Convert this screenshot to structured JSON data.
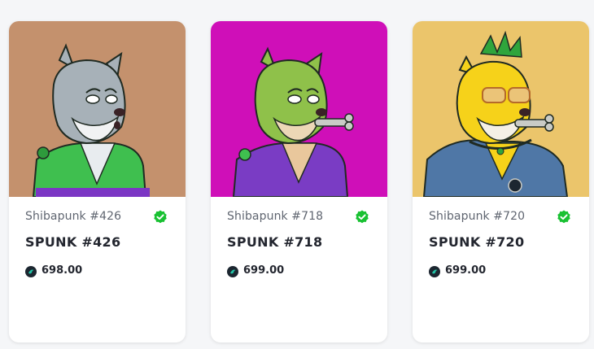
{
  "cards": [
    {
      "collection": "Shibapunk #426",
      "name": "SPUNK #426",
      "price": "698.00",
      "colors": {
        "background": "#c4916d",
        "fur": "#a7b1b8",
        "shirt": "#3fbf4f",
        "accent": "#7b36c4"
      }
    },
    {
      "collection": "Shibapunk #718",
      "name": "SPUNK #718",
      "price": "699.00",
      "colors": {
        "background": "#cf0fb8",
        "fur": "#8fc14a",
        "shirt": "#7a3cc4",
        "accent": "#3fbf4f"
      }
    },
    {
      "collection": "Shibapunk #720",
      "name": "SPUNK #720",
      "price": "699.00",
      "colors": {
        "background": "#ebc56b",
        "fur": "#f6d21a",
        "shirt": "#4f77a6",
        "accent": "#2fa53c"
      }
    }
  ],
  "icons": {
    "verified": "verified-check-icon",
    "currency": "coin-icon"
  },
  "accent_colors": {
    "verified": "#19c132",
    "text_primary": "#23262f",
    "text_secondary": "#5f6570"
  }
}
